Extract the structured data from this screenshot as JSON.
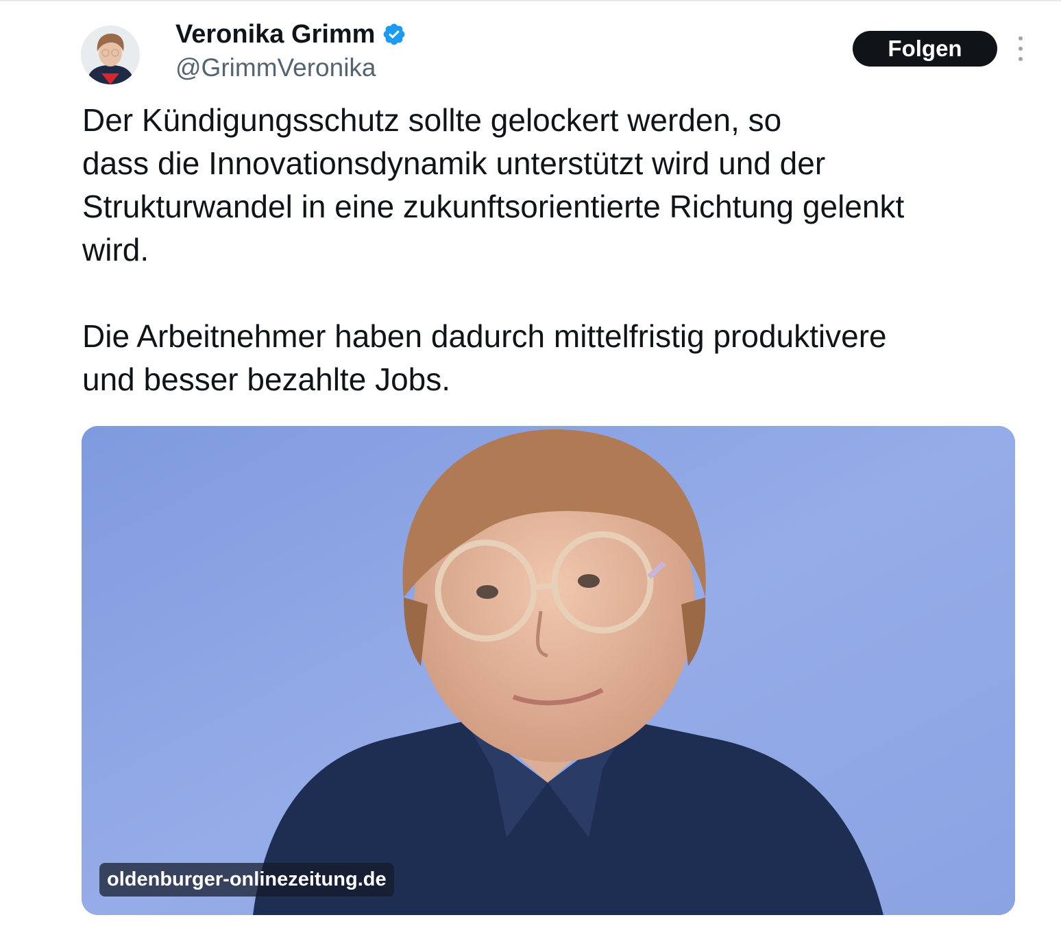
{
  "tweet": {
    "author": {
      "display_name": "Veronika Grimm",
      "handle": "@GrimmVeronika",
      "verified": true,
      "avatar_icon": "profile-photo"
    },
    "follow_label": "Folgen",
    "more_icon": "more-vertical-icon",
    "text_lines": [
      "Der Kündigungsschutz sollte gelockert werden, so",
      "dass die Innovationsdynamik unterstützt wird und der",
      "Strukturwandel in eine zukunftsorientierte Richtung gelenkt",
      "wird.",
      "Die Arbeitnehmer haben dadurch mittelfristig produktivere",
      "und besser bezahlte Jobs."
    ],
    "media": {
      "source_domain": "oldenburger-onlinezeitung.de"
    }
  },
  "colors": {
    "text_primary": "#0f1419",
    "text_secondary": "#536471",
    "follow_button_bg": "#0f1419",
    "verified_blue": "#1d9bf0",
    "media_background": "#8fa6e6"
  }
}
